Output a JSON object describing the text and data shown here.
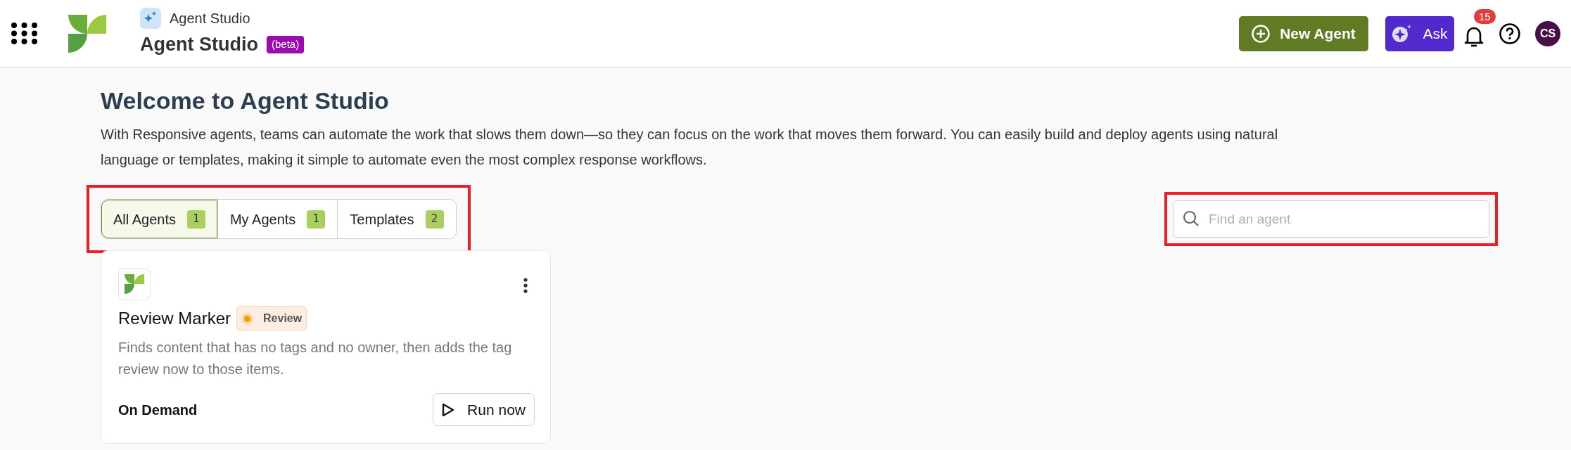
{
  "header": {
    "product_caption": "Agent Studio",
    "title": "Agent Studio",
    "title_badge": "(beta)",
    "new_button": "New Agent",
    "ask_button": "Ask",
    "notifications_count": "15",
    "avatar_initials": "CS"
  },
  "page": {
    "heading": "Welcome to Agent Studio",
    "description": "With Responsive agents, teams can automate the work that slows them down—so they can focus on the work that moves them forward. You can easily build and deploy agents using natural language or templates, making it simple to automate even the most complex response workflows."
  },
  "tabs": {
    "highlighted": true,
    "items": [
      {
        "label": "All Agents",
        "count": "1",
        "selected": true
      },
      {
        "label": "My Agents",
        "count": "1",
        "selected": false
      },
      {
        "label": "Templates",
        "count": "2",
        "selected": false
      }
    ]
  },
  "search": {
    "placeholder": "Find an agent",
    "highlighted": true
  },
  "cards": [
    {
      "name": "Review Marker",
      "status": "Review",
      "color": "#f59e0b",
      "description": "Finds content that has no tags and no owner, then adds the tag review now to those items.",
      "trigger": "On Demand",
      "action": "Run now"
    }
  ]
}
